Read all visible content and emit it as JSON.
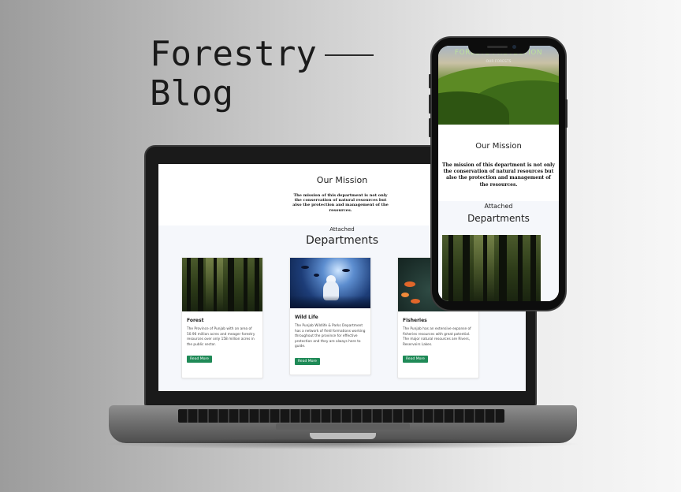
{
  "headline": {
    "line1": "Forestry",
    "line2": "Blog"
  },
  "site": {
    "hero": {
      "title": "FORESTS PROTECTION",
      "subtitle": "OUR FORESTS"
    },
    "mission": {
      "title": "Our Mission",
      "text": "The mission of this department is not only the conservation of natural resources but also the protection and management of the resources."
    },
    "departments": {
      "eyebrow": "Attached",
      "title": "Departments",
      "cards": [
        {
          "title": "Forest",
          "text": "The Province of Punjab with an area of 50.96 million acres and meager forestry resources over only 158 million acres in the public sector.",
          "button": "Read More",
          "image_icon": "forest-image"
        },
        {
          "title": "Wild Life",
          "text": "The Punjab Wildlife & Parks Department has a network of field formations working throughout the province for effective protection and they are always here to guide.",
          "button": "Read More",
          "image_icon": "wildlife-image"
        },
        {
          "title": "Fisheries",
          "text": "The Punjab has an extensive expanse of fisheries resources with great potential. The major natural resources are Rivers, Reservoirs Lakes.",
          "button": "Read More",
          "image_icon": "fisheries-image"
        }
      ]
    }
  },
  "colors": {
    "button": "#1f8a57",
    "background_left": "#9c9c9c",
    "background_right": "#f7f7f7"
  }
}
